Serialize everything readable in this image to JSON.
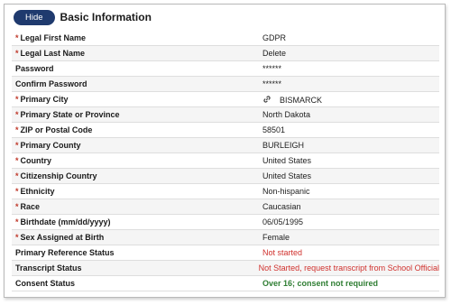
{
  "header": {
    "hide_label": "Hide",
    "title": "Basic Information"
  },
  "fields": [
    {
      "label": "Legal First Name",
      "required": true,
      "value": "GDPR"
    },
    {
      "label": "Legal Last Name",
      "required": true,
      "value": "Delete"
    },
    {
      "label": "Password",
      "required": false,
      "value": "******"
    },
    {
      "label": "Confirm Password",
      "required": false,
      "value": "******"
    },
    {
      "label": "Primary City",
      "required": true,
      "value": "BISMARCK",
      "icon": "link-icon"
    },
    {
      "label": "Primary State or Province",
      "required": true,
      "value": "North Dakota"
    },
    {
      "label": "ZIP or Postal Code",
      "required": true,
      "value": "58501"
    },
    {
      "label": "Primary County",
      "required": true,
      "value": "BURLEIGH"
    },
    {
      "label": "Country",
      "required": true,
      "value": "United States"
    },
    {
      "label": "Citizenship Country",
      "required": true,
      "value": "United States"
    },
    {
      "label": "Ethnicity",
      "required": true,
      "value": "Non-hispanic"
    },
    {
      "label": "Race",
      "required": true,
      "value": "Caucasian"
    },
    {
      "label": "Birthdate (mm/dd/yyyy)",
      "required": true,
      "value": "06/05/1995"
    },
    {
      "label": "Sex Assigned at Birth",
      "required": true,
      "value": "Female"
    },
    {
      "label": "Primary Reference Status",
      "required": false,
      "value": "Not started",
      "status": "red"
    },
    {
      "label": "Transcript Status",
      "required": false,
      "value": "Not Started, request transcript from School Official",
      "status": "red"
    },
    {
      "label": "Consent Status",
      "required": false,
      "value": "Over 16; consent not required",
      "status": "green"
    }
  ],
  "required_marker": "*",
  "colors": {
    "button_bg": "#1f3a6e",
    "required": "#c0392b",
    "status_red": "#d0312d",
    "status_green": "#2e7d32"
  }
}
